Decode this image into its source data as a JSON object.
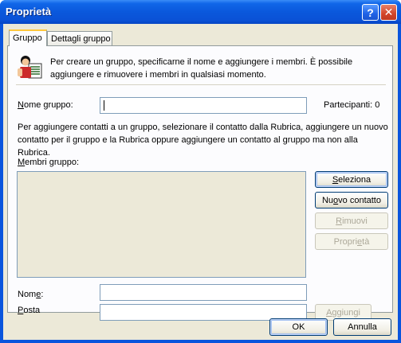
{
  "window": {
    "title": "Proprietà",
    "help_glyph": "?",
    "close_glyph": "✕"
  },
  "tabs": [
    {
      "label": "Gruppo"
    },
    {
      "label": "Dettagli gruppo"
    }
  ],
  "intro": {
    "text": "Per creare un gruppo, specificarne il nome e aggiungere i membri. È possibile aggiungere e rimuovere i membri in qualsiasi momento."
  },
  "group_name": {
    "label_mnemonic": "N",
    "label_rest": "ome gruppo:",
    "value": "",
    "participants": "Partecipanti: 0"
  },
  "instructions": "Per aggiungere contatti a un gruppo, selezionare il contatto dalla Rubrica, aggiungere un nuovo contatto per il gruppo e la Rubrica oppure aggiungere un contatto al gruppo ma non alla Rubrica.",
  "members": {
    "label_mnemonic": "M",
    "label_rest": "embri gruppo:",
    "items": []
  },
  "side_buttons": {
    "select_m": "S",
    "select_rest": "eleziona",
    "new_pre": "Nu",
    "new_m": "o",
    "new_rest": "vo contatto",
    "remove_m": "R",
    "remove_rest": "imuovi",
    "props_pre": "Propri",
    "props_m": "e",
    "props_rest": "tà"
  },
  "contact": {
    "name_pre": "Nom",
    "name_m": "e",
    "name_rest": ":",
    "name_value": "",
    "mail_m": "P",
    "mail_rest": "osta",
    "mail_value": "",
    "add_m": "A",
    "add_rest": "ggiungi"
  },
  "footer": {
    "ok": "OK",
    "cancel": "Annulla"
  }
}
